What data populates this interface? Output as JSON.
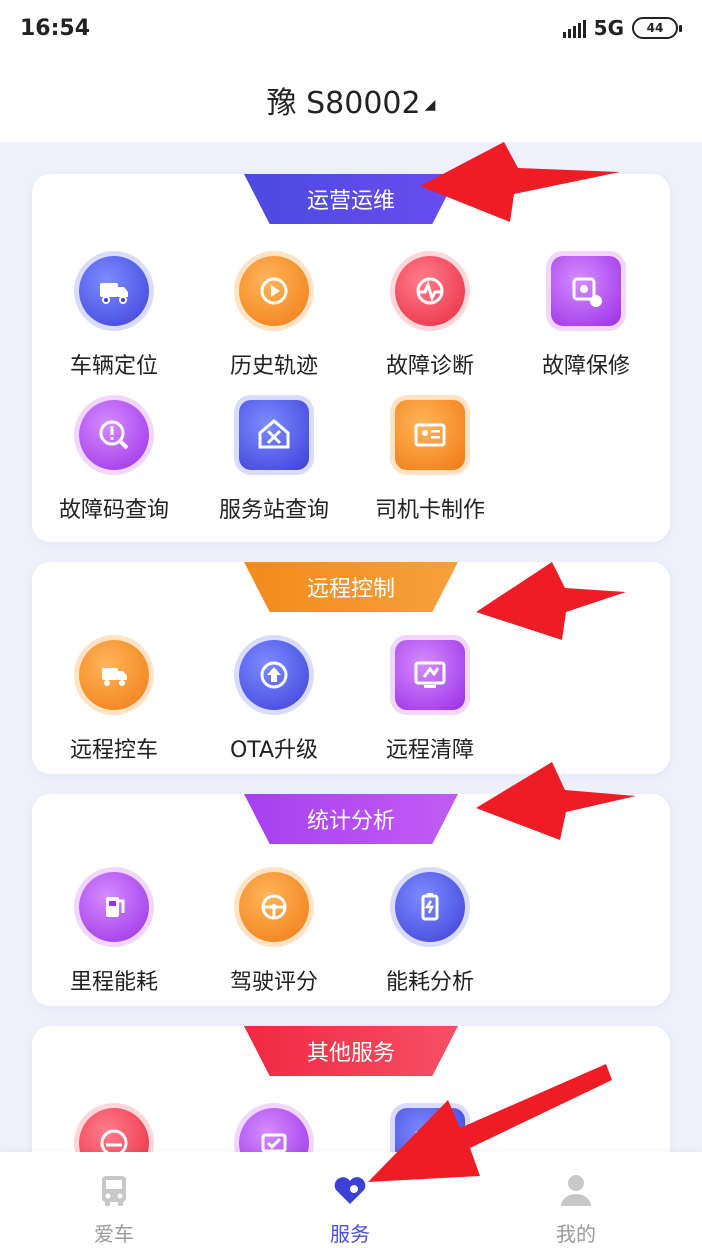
{
  "status": {
    "time": "16:54",
    "network": "5G",
    "battery": "44"
  },
  "header": {
    "title": "豫 S80002",
    "caret": "◢"
  },
  "sections": [
    {
      "title": "运营运维",
      "items": [
        {
          "label": "车辆定位",
          "icon": "truck-locate-icon"
        },
        {
          "label": "历史轨迹",
          "icon": "history-track-icon"
        },
        {
          "label": "故障诊断",
          "icon": "fault-diagnosis-icon"
        },
        {
          "label": "故障保修",
          "icon": "fault-repair-icon"
        },
        {
          "label": "故障码查询",
          "icon": "fault-code-search-icon"
        },
        {
          "label": "服务站查询",
          "icon": "service-station-icon"
        },
        {
          "label": "司机卡制作",
          "icon": "driver-card-icon"
        }
      ]
    },
    {
      "title": "远程控制",
      "items": [
        {
          "label": "远程控车",
          "icon": "remote-control-icon"
        },
        {
          "label": "OTA升级",
          "icon": "ota-upgrade-icon"
        },
        {
          "label": "远程清障",
          "icon": "remote-clear-icon"
        }
      ]
    },
    {
      "title": "统计分析",
      "items": [
        {
          "label": "里程能耗",
          "icon": "mileage-energy-icon"
        },
        {
          "label": "驾驶评分",
          "icon": "driving-score-icon"
        },
        {
          "label": "能耗分析",
          "icon": "energy-analysis-icon"
        }
      ]
    },
    {
      "title": "其他服务",
      "items": [
        {
          "label": "",
          "icon": "ok-gauge-icon"
        },
        {
          "label": "",
          "icon": "battery-check-icon"
        },
        {
          "label": "",
          "icon": "map-icon"
        }
      ]
    }
  ],
  "nav": [
    {
      "label": "爱车",
      "icon": "car-icon",
      "active": false
    },
    {
      "label": "服务",
      "icon": "heart-service-icon",
      "active": true
    },
    {
      "label": "我的",
      "icon": "user-icon",
      "active": false
    }
  ],
  "colors": {
    "accent": "#4a4fe0",
    "tab_blue": "#4b4ae0",
    "tab_orange": "#f38a1c",
    "tab_purple": "#a640f0",
    "tab_red": "#f02942",
    "arrow": "#ee1c25"
  }
}
